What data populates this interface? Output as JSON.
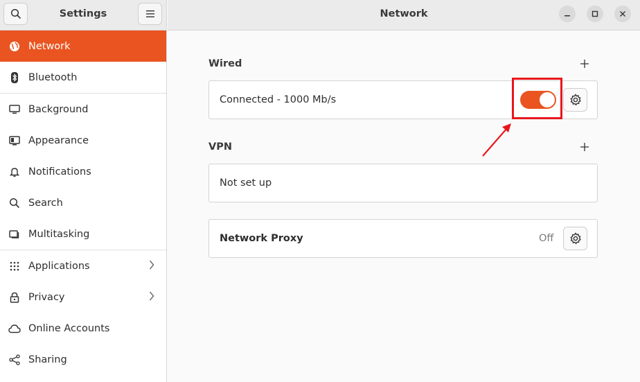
{
  "sidebar": {
    "title": "Settings",
    "items": [
      {
        "label": "Network",
        "icon": "globe-icon",
        "active": true
      },
      {
        "label": "Bluetooth",
        "icon": "bluetooth-icon"
      },
      {
        "label": "Background",
        "icon": "monitor-icon"
      },
      {
        "label": "Appearance",
        "icon": "appearance-icon"
      },
      {
        "label": "Notifications",
        "icon": "bell-icon"
      },
      {
        "label": "Search",
        "icon": "search-icon"
      },
      {
        "label": "Multitasking",
        "icon": "multitasking-icon"
      },
      {
        "label": "Applications",
        "icon": "grid-icon",
        "chevron": true
      },
      {
        "label": "Privacy",
        "icon": "lock-icon",
        "chevron": true
      },
      {
        "label": "Online Accounts",
        "icon": "cloud-icon"
      },
      {
        "label": "Sharing",
        "icon": "share-icon"
      }
    ]
  },
  "main": {
    "title": "Network",
    "wired": {
      "label": "Wired",
      "status": "Connected - 1000 Mb/s",
      "toggle_on": true
    },
    "vpn": {
      "label": "VPN",
      "status": "Not set up"
    },
    "proxy": {
      "label": "Network Proxy",
      "state": "Off"
    }
  },
  "colors": {
    "accent": "#e95420",
    "highlight": "#e8161c"
  }
}
